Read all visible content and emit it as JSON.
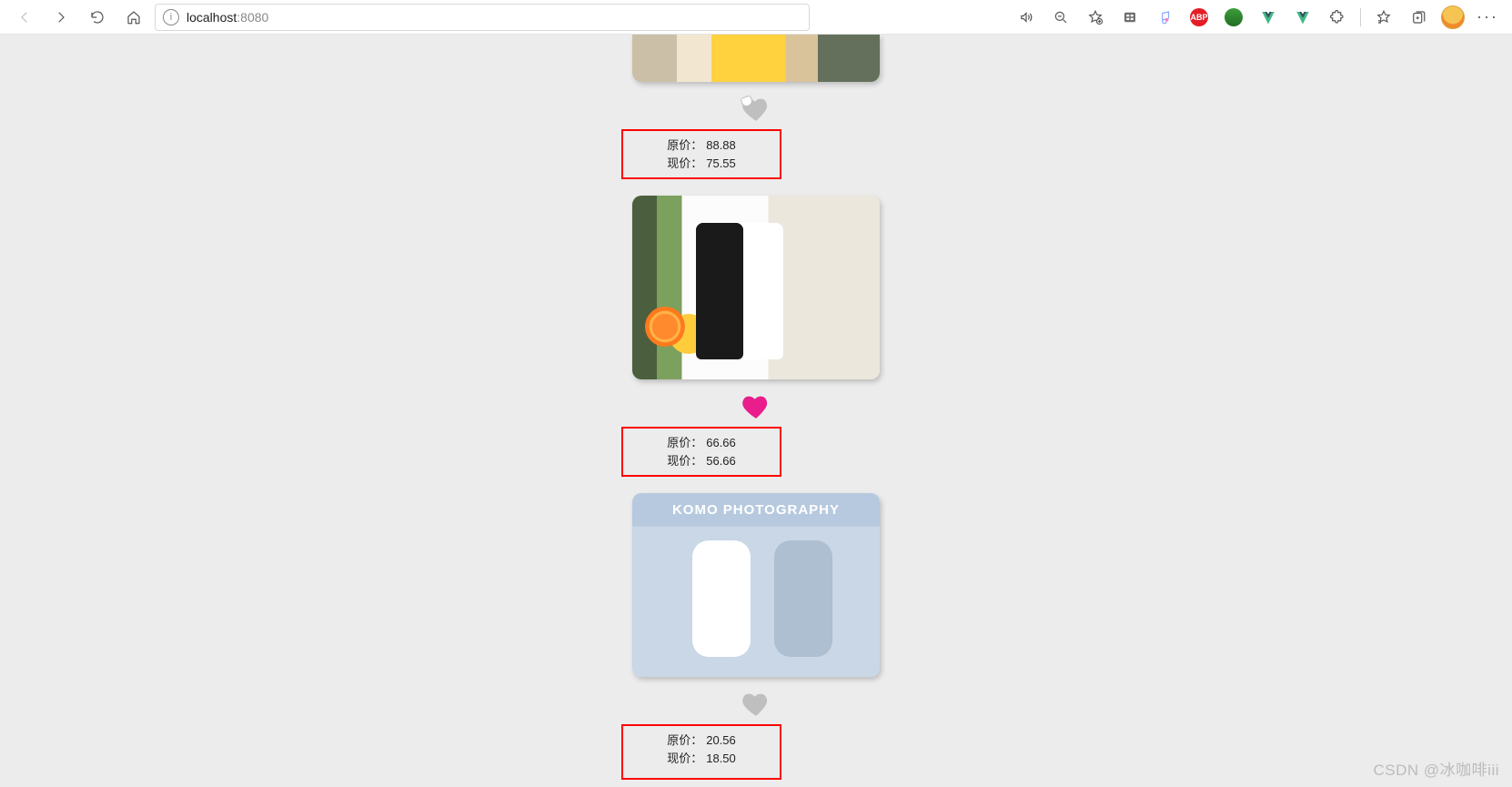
{
  "browser": {
    "url_host": "localhost",
    "url_port": ":8080"
  },
  "labels": {
    "original_price": "原价：",
    "current_price": "现价："
  },
  "products": [
    {
      "image": "duck",
      "liked": false,
      "heart_style": "partial",
      "original": "88.88",
      "current": "75.55",
      "image_overlay_text": ""
    },
    {
      "image": "cups",
      "liked": true,
      "heart_style": "filled",
      "original": "66.66",
      "current": "56.66",
      "image_overlay_text": ""
    },
    {
      "image": "komo",
      "liked": false,
      "heart_style": "empty",
      "original": "20.56",
      "current": "18.50",
      "image_overlay_text": "KOMO PHOTOGRAPHY"
    }
  ],
  "watermark": "CSDN @冰咖啡iii"
}
